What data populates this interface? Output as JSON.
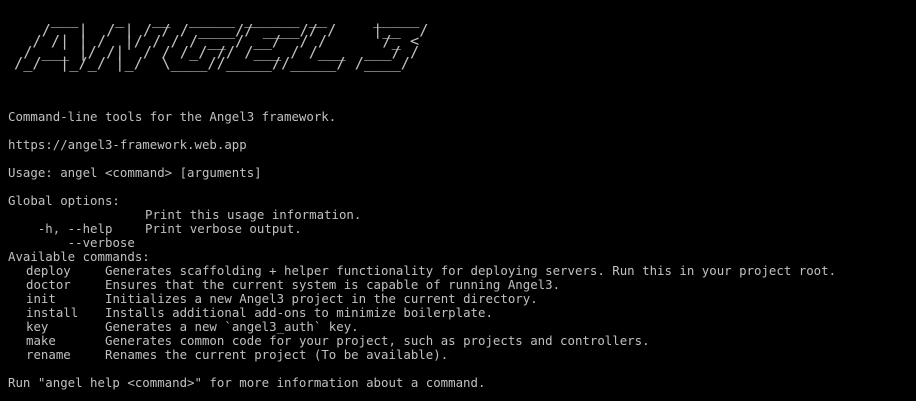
{
  "banner": {
    "lines": [
      "    ___    _   __  _____ ______ __     _____",
      "   /   |  / | / / / ____// ____// /    |__  /",
      "  / /| | /  |/ / / / __ / __/  / /      /_ < ",
      " / ___ |/ /|  / / /_/ // /___ / /___  ___/ / ",
      "/_/  |_/_/ |_/  \\____//_____//_____/ /____/  "
    ]
  },
  "description": "Command-line tools for the Angel3 framework.",
  "url": "https://angel3-framework.web.app",
  "usage": "Usage: angel <command> [arguments]",
  "global_options": {
    "header": "Global options:",
    "items": [
      {
        "flag": "-h, --help",
        "desc": "Print this usage information."
      },
      {
        "flag": "    --verbose",
        "desc": "Print verbose output."
      }
    ]
  },
  "available_commands": {
    "header": "Available commands:",
    "items": [
      {
        "name": "deploy",
        "desc": "Generates scaffolding + helper functionality for deploying servers. Run this in your project root."
      },
      {
        "name": "doctor",
        "desc": "Ensures that the current system is capable of running Angel3."
      },
      {
        "name": "init",
        "desc": "Initializes a new Angel3 project in the current directory."
      },
      {
        "name": "install",
        "desc": "Installs additional add-ons to minimize boilerplate."
      },
      {
        "name": "key",
        "desc": "Generates a new `angel3_auth` key."
      },
      {
        "name": "make",
        "desc": "Generates common code for your project, such as projects and controllers."
      },
      {
        "name": "rename",
        "desc": "Renames the current project (To be available)."
      }
    ]
  },
  "footer": "Run \"angel help <command>\" for more information about a command."
}
